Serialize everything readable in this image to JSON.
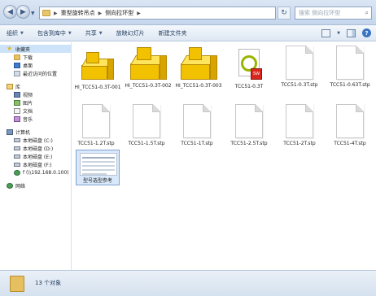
{
  "address": {
    "segments": [
      "重型旋转吊点",
      "侧向拉环型"
    ],
    "search_placeholder": "搜索 侧向拉环型"
  },
  "toolbar": {
    "organize": "组织",
    "include_in_library": "包含到库中",
    "share": "共享",
    "slideshow": "放映幻灯片",
    "new_folder": "新建文件夹"
  },
  "nav": {
    "favorites": "收藏夹",
    "downloads": "下载",
    "desktop": "桌面",
    "recent": "最近访问的位置",
    "libraries": "库",
    "videos": "视频",
    "pictures": "图片",
    "documents": "文档",
    "music": "音乐",
    "computer": "计算机",
    "drive_c": "本地磁盘 (C:)",
    "drive_d": "本地磁盘 (D:)",
    "drive_e": "本地磁盘 (E:)",
    "drive_f": "本地磁盘 (F:)",
    "network_drive": "f (\\\\192.168.0.100)",
    "network": "网络"
  },
  "files": {
    "f1": "HI_TCC51-0.3T-001",
    "f2": "HI_TCC51-0.3T-002",
    "f3": "HI_TCC51-0.3T-003",
    "f4": "TCC51-0.3T",
    "f5": "TCC51-0.3T.stp",
    "f6": "TCC51-0.63T.stp",
    "f7": "TCC51-1.2T.stp",
    "f8": "TCC51-1.5T.stp",
    "f9": "TCC51-1T.stp",
    "f10": "TCC51-2.5T.stp",
    "f11": "TCC51-2T.stp",
    "f12": "TCC51-4T.stp",
    "f13": "型号选型参考"
  },
  "status": {
    "count": "13 个对象"
  },
  "icons": {
    "back": "back-arrow-icon",
    "forward": "forward-arrow-icon",
    "refresh": "refresh-icon",
    "search": "search-icon",
    "help": "help-icon"
  },
  "colors": {
    "window_chrome": "#dbe6f4",
    "selection": "#cce3f9",
    "folder": "#e7c263",
    "part_yellow": "#f2c100"
  }
}
